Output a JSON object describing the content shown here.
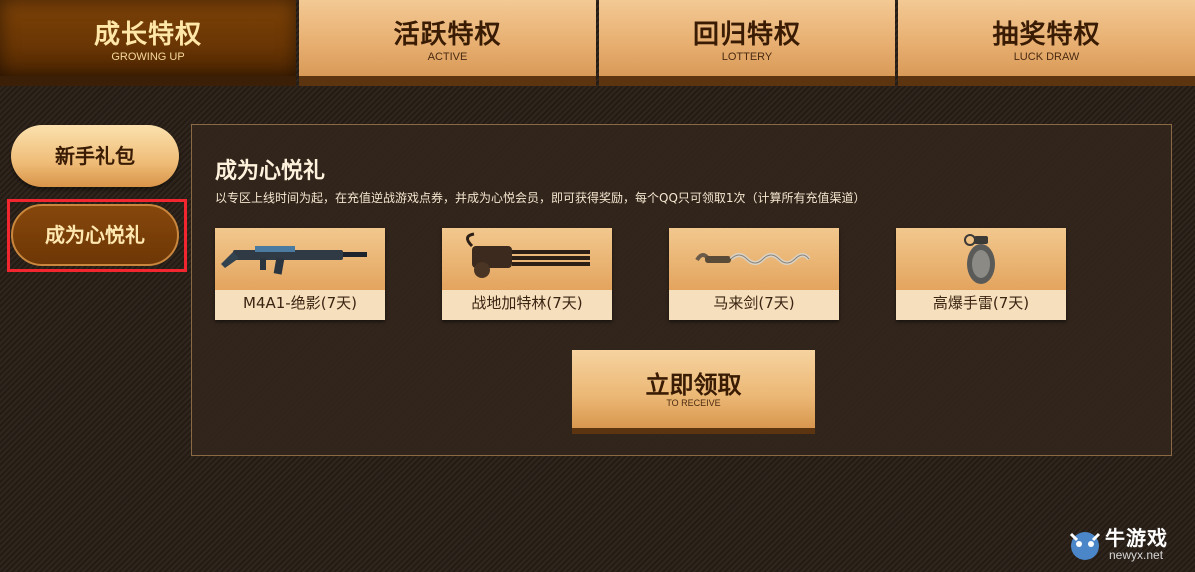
{
  "tabs": [
    {
      "zh": "成长特权",
      "en": "GROWING UP"
    },
    {
      "zh": "活跃特权",
      "en": "ACTIVE"
    },
    {
      "zh": "回归特权",
      "en": "LOTTERY"
    },
    {
      "zh": "抽奖特权",
      "en": "LUCK DRAW"
    }
  ],
  "sidebar": {
    "items": [
      {
        "label": "新手礼包"
      },
      {
        "label": "成为心悦礼"
      }
    ]
  },
  "panel": {
    "title": "成为心悦礼",
    "desc": "以专区上线时间为起，在充值逆战游戏点券，并成为心悦会员，即可获得奖励，每个QQ只可领取1次（计算所有充值渠道）",
    "items": [
      {
        "name": "M4A1-绝影(7天)",
        "icon": "rifle-icon"
      },
      {
        "name": "战地加特林(7天)",
        "icon": "gatling-icon"
      },
      {
        "name": "马来剑(7天)",
        "icon": "kris-sword-icon"
      },
      {
        "name": "高爆手雷(7天)",
        "icon": "grenade-icon"
      }
    ],
    "receive": {
      "zh": "立即领取",
      "en": "TO RECEIVE"
    }
  },
  "watermark": {
    "brand": "牛游戏",
    "url": "newyx.net"
  },
  "colors": {
    "accent": "#f2262e",
    "active_tab": "#6a3604",
    "tab": "#e8b072"
  }
}
